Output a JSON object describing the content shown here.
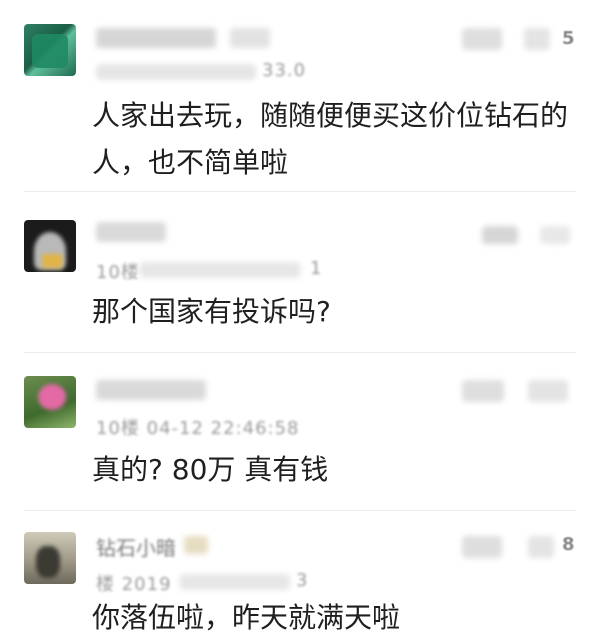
{
  "comments": [
    {
      "text": "人家出去玩，随随便便买这价位钻石的人，也不简单啦",
      "meta": "33.0",
      "like_count": "5"
    },
    {
      "text": "那个国家有投诉吗?",
      "meta": "10楼",
      "meta_tail": "1"
    },
    {
      "text": "真的? 80万 真有钱",
      "meta": "10楼 04-12 22:46:58"
    },
    {
      "name": "钻石小暗",
      "text": "你落伍啦，昨天就满天啦",
      "meta": "楼 2019",
      "meta_tail": "3",
      "like_count": "8"
    }
  ],
  "colors": {
    "background": "#ffffff",
    "text": "#1f1f1f",
    "meta": "#9a9a9a",
    "divider": "#ececec"
  }
}
